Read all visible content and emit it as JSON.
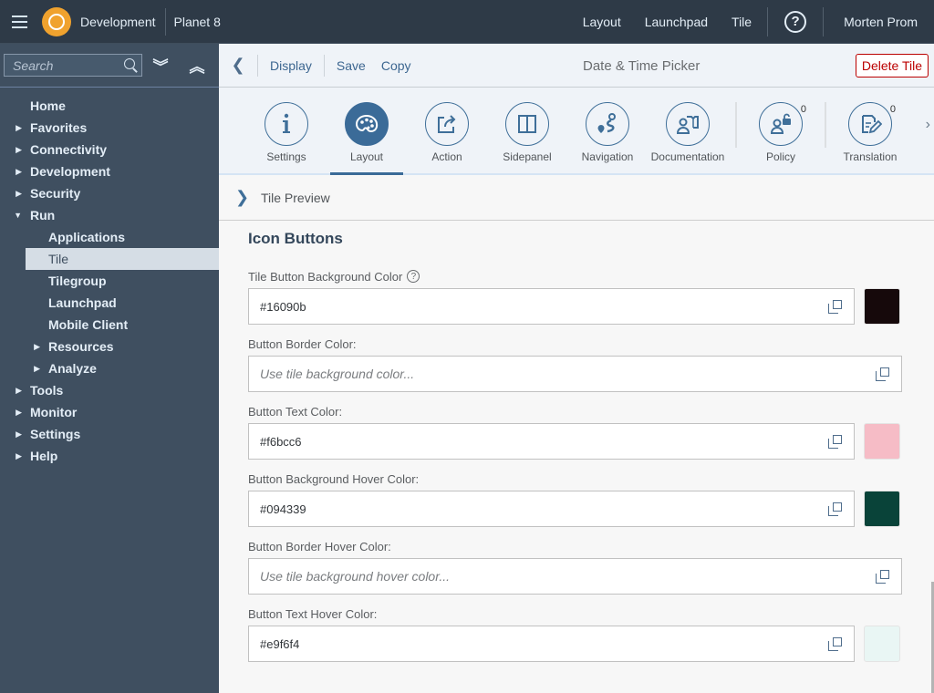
{
  "shell": {
    "app_title": "Development",
    "system_name": "Planet 8",
    "links": [
      "Layout",
      "Launchpad",
      "Tile"
    ],
    "help_icon": "question-mark-icon",
    "user_name": "Morten Prom"
  },
  "sidebar": {
    "search_placeholder": "Search",
    "expand_all_icon": "double-chevron-down-icon",
    "collapse_all_icon": "double-chevron-up-icon",
    "items": [
      {
        "label": "Home",
        "level": 1,
        "arrow": ""
      },
      {
        "label": "Favorites",
        "level": 1,
        "arrow": "▶"
      },
      {
        "label": "Connectivity",
        "level": 1,
        "arrow": "▶"
      },
      {
        "label": "Development",
        "level": 1,
        "arrow": "▶"
      },
      {
        "label": "Security",
        "level": 1,
        "arrow": "▶"
      },
      {
        "label": "Run",
        "level": 1,
        "arrow": "▼"
      },
      {
        "label": "Applications",
        "level": 2,
        "arrow": ""
      },
      {
        "label": "Tile",
        "level": 2,
        "arrow": "",
        "selected": true
      },
      {
        "label": "Tilegroup",
        "level": 2,
        "arrow": ""
      },
      {
        "label": "Launchpad",
        "level": 2,
        "arrow": ""
      },
      {
        "label": "Mobile Client",
        "level": 2,
        "arrow": ""
      },
      {
        "label": "Resources",
        "level": 2,
        "arrow": "▶"
      },
      {
        "label": "Analyze",
        "level": 2,
        "arrow": "▶"
      },
      {
        "label": "Tools",
        "level": 1,
        "arrow": "▶"
      },
      {
        "label": "Monitor",
        "level": 1,
        "arrow": "▶"
      },
      {
        "label": "Settings",
        "level": 1,
        "arrow": "▶"
      },
      {
        "label": "Help",
        "level": 1,
        "arrow": "▶"
      }
    ]
  },
  "toolbar": {
    "back_icon": "chevron-left-icon",
    "display_label": "Display",
    "save_label": "Save",
    "copy_label": "Copy",
    "title": "Date & Time Picker",
    "delete_label": "Delete Tile"
  },
  "iconbar": {
    "active": "Layout",
    "items": [
      {
        "label": "Settings",
        "icon": "info-icon"
      },
      {
        "label": "Layout",
        "icon": "palette-icon"
      },
      {
        "label": "Action",
        "icon": "share-icon"
      },
      {
        "label": "Sidepanel",
        "icon": "split-panel-icon"
      },
      {
        "label": "Navigation",
        "icon": "route-icon"
      },
      {
        "label": "Documentation",
        "icon": "user-manual-icon"
      },
      {
        "label": "Policy",
        "icon": "user-lock-icon",
        "badge": "0"
      },
      {
        "label": "Translation",
        "icon": "document-edit-icon",
        "badge": "0"
      }
    ],
    "next_icon": "chevron-right-icon"
  },
  "preview": {
    "label": "Tile Preview"
  },
  "form": {
    "section_title": "Icon Buttons",
    "fields": [
      {
        "label": "Tile Button Background Color",
        "value": "#16090b",
        "placeholder": "",
        "swatch": "#16090b",
        "help": true
      },
      {
        "label": "Button Border Color:",
        "value": "",
        "placeholder": "Use tile background color...",
        "swatch": null
      },
      {
        "label": "Button Text Color:",
        "value": "#f6bcc6",
        "placeholder": "",
        "swatch": "#f6bcc6"
      },
      {
        "label": "Button Background Hover Color:",
        "value": "#094339",
        "placeholder": "",
        "swatch": "#094339"
      },
      {
        "label": "Button Border Hover Color:",
        "value": "",
        "placeholder": "Use tile background hover color...",
        "swatch": null
      },
      {
        "label": "Button Text Hover Color:",
        "value": "#e9f6f4",
        "placeholder": "",
        "swatch": "#e9f6f4"
      }
    ]
  }
}
